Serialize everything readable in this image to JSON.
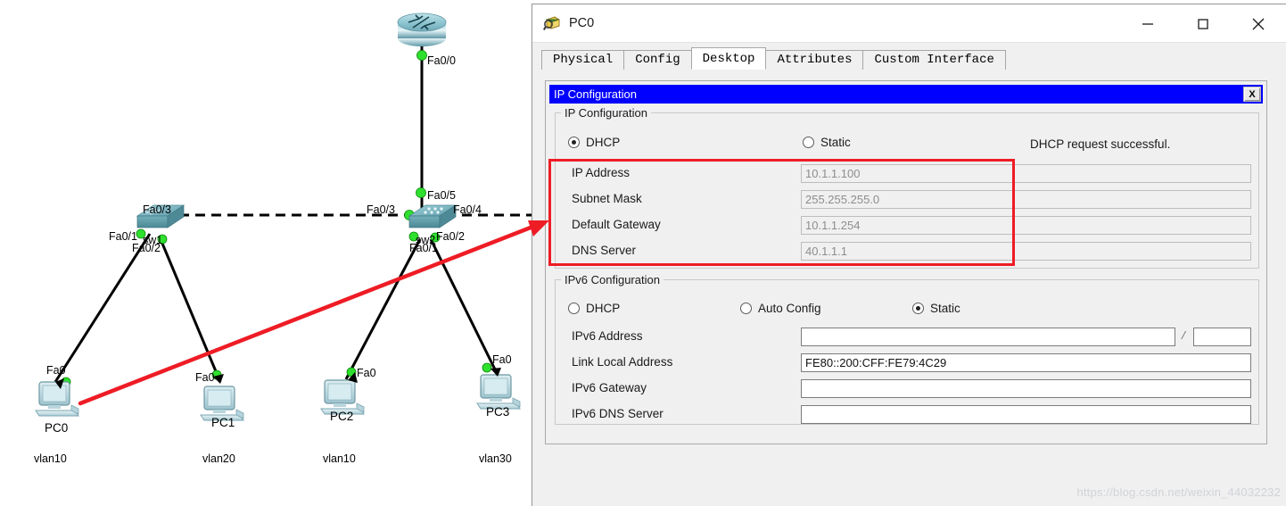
{
  "window": {
    "title": "PC0",
    "icon": "packet-tracer-device-icon",
    "minimize": "—",
    "maximize": "☐",
    "close": "✕"
  },
  "tabs": [
    {
      "label": "Physical",
      "active": false
    },
    {
      "label": "Config",
      "active": false
    },
    {
      "label": "Desktop",
      "active": true
    },
    {
      "label": "Attributes",
      "active": false
    },
    {
      "label": "Custom Interface",
      "active": false
    }
  ],
  "inner_window": {
    "title": "IP Configuration",
    "close_label": "X"
  },
  "ipv4": {
    "legend": "IP Configuration",
    "modes": [
      {
        "label": "DHCP",
        "selected": true
      },
      {
        "label": "Static",
        "selected": false
      }
    ],
    "status": "DHCP request successful.",
    "fields": [
      {
        "label": "IP Address",
        "value": "10.1.1.100",
        "editable": false
      },
      {
        "label": "Subnet Mask",
        "value": "255.255.255.0",
        "editable": false
      },
      {
        "label": "Default Gateway",
        "value": "10.1.1.254",
        "editable": false
      },
      {
        "label": "DNS Server",
        "value": "40.1.1.1",
        "editable": false
      }
    ]
  },
  "ipv6": {
    "legend": "IPv6 Configuration",
    "modes": [
      {
        "label": "DHCP",
        "selected": false
      },
      {
        "label": "Auto Config",
        "selected": false
      },
      {
        "label": "Static",
        "selected": true
      }
    ],
    "fields": [
      {
        "label": "IPv6 Address",
        "value": "",
        "editable": true,
        "has_prefix": true,
        "prefix": ""
      },
      {
        "label": "Link Local Address",
        "value": "FE80::200:CFF:FE79:4C29",
        "editable": true
      },
      {
        "label": "IPv6 Gateway",
        "value": "",
        "editable": true
      },
      {
        "label": "IPv6 DNS Server",
        "value": "",
        "editable": true
      }
    ]
  },
  "topology": {
    "router": {
      "name": "",
      "port": "Fa0/0"
    },
    "switches": [
      {
        "name": "sw1",
        "ports": [
          "Fa0/3",
          "Fa0/1",
          "Fa0/2"
        ]
      },
      {
        "name": "sw2",
        "ports": [
          "Fa0/5",
          "Fa0/3",
          "Fa0/4",
          "Fa0/2",
          "Fa0/1"
        ]
      }
    ],
    "pcs": [
      {
        "name": "PC0",
        "port": "Fa0",
        "vlan": "vlan10"
      },
      {
        "name": "PC1",
        "port": "Fa0",
        "vlan": "vlan20"
      },
      {
        "name": "PC2",
        "port": "Fa0",
        "vlan": "vlan10"
      },
      {
        "name": "PC3",
        "port": "Fa0",
        "vlan": "vlan30"
      }
    ]
  },
  "watermark": "https://blog.csdn.net/weixin_44032232",
  "colors": {
    "accent_blue": "#0000ff",
    "highlight_red": "#ee1c25",
    "link_green": "#33e033",
    "device_teal": "#6ba4b3"
  }
}
